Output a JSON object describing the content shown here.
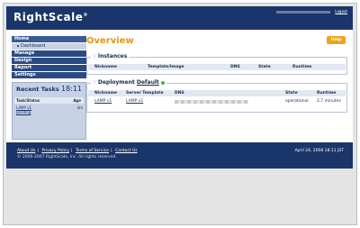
{
  "header": {
    "logo": "RightScale",
    "trademark": "®",
    "logout": "Logout"
  },
  "sidebar": {
    "items": [
      {
        "label": "Home",
        "active": true
      },
      {
        "label": "Dashboard",
        "sub": true
      },
      {
        "label": "Manage"
      },
      {
        "label": "Design"
      },
      {
        "label": "Report"
      },
      {
        "label": "Settings"
      }
    ],
    "tasks": {
      "title": "Recent Tasks",
      "time": "18:11",
      "col_task": "Task/Status",
      "col_age": "Age",
      "rows": [
        {
          "name": "LAMP v1",
          "status": "pending",
          "age": "4m"
        }
      ]
    }
  },
  "main": {
    "title": "Overview",
    "help_label": "Help",
    "instances": {
      "title": "Instances",
      "columns": [
        "Nickname",
        "Template/Image",
        "DNS",
        "State",
        "Runtime"
      ]
    },
    "deployment": {
      "title_prefix": "Deployment",
      "title_link": "Default",
      "columns": [
        "Nickname",
        "Server Template",
        "DNS",
        "State",
        "Runtime"
      ],
      "rows": [
        {
          "nickname": "LAMP v1",
          "template": "LAMP v1",
          "state": "operational",
          "runtime": "2.7 minutes"
        }
      ]
    }
  },
  "footer": {
    "links": [
      "About Us",
      "Privacy Policy",
      "Terms of Service",
      "Contact Us"
    ],
    "separator": "|",
    "copyright": "© 2006-2007 RightScale, Inc. All rights reserved.",
    "date": "April 24, 2008 18:11 JST"
  },
  "colors": {
    "navy": "#1a3569",
    "accent": "#f0a419",
    "title": "#e89412",
    "status_ok": "#4fae3a"
  }
}
